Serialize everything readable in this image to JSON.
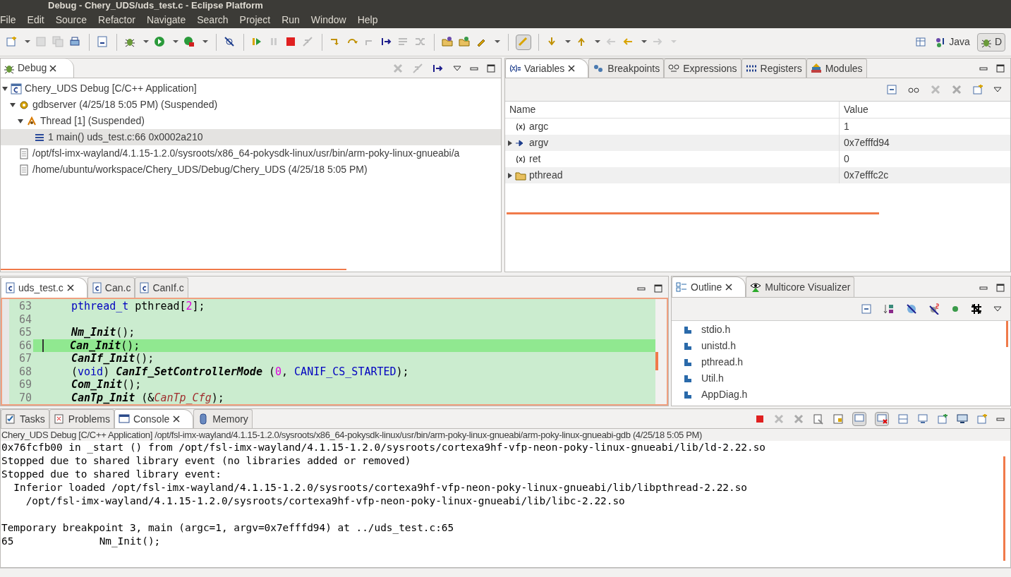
{
  "window": {
    "title": "Debug - Chery_UDS/uds_test.c - Eclipse Platform"
  },
  "menu": [
    {
      "label": "File"
    },
    {
      "label": "Edit"
    },
    {
      "label": "Source"
    },
    {
      "label": "Refactor"
    },
    {
      "label": "Navigate"
    },
    {
      "label": "Search"
    },
    {
      "label": "Project"
    },
    {
      "label": "Run"
    },
    {
      "label": "Window"
    },
    {
      "label": "Help"
    }
  ],
  "perspectives": [
    {
      "label": "Java",
      "selected": false
    },
    {
      "label": "D",
      "selected": true
    }
  ],
  "debug_view": {
    "tab": "Debug",
    "tree": [
      {
        "label": "Chery_UDS Debug [C/C++ Application]",
        "kind": "launch",
        "expanded": true,
        "selected": false,
        "children": [
          {
            "label": "gdbserver (4/25/18 5:05 PM) (Suspended)",
            "kind": "process",
            "expanded": true,
            "selected": false,
            "children": [
              {
                "label": "Thread [1] (Suspended)",
                "kind": "thread",
                "expanded": true,
                "selected": false,
                "children": [
                  {
                    "label": "1 main() uds_test.c:66 0x0002a210",
                    "kind": "frame",
                    "selected": true
                  }
                ]
              }
            ]
          },
          {
            "label": "/opt/fsl-imx-wayland/4.1.15-1.2.0/sysroots/x86_64-pokysdk-linux/usr/bin/arm-poky-linux-gnueabi/a",
            "kind": "file",
            "selected": false
          },
          {
            "label": "/home/ubuntu/workspace/Chery_UDS/Debug/Chery_UDS (4/25/18 5:05 PM)",
            "kind": "file",
            "selected": false
          }
        ]
      }
    ]
  },
  "variables_view": {
    "tabs": [
      {
        "label": "Variables",
        "selected": true
      },
      {
        "label": "Breakpoints",
        "selected": false
      },
      {
        "label": "Expressions",
        "selected": false
      },
      {
        "label": "Registers",
        "selected": false
      },
      {
        "label": "Modules",
        "selected": false
      }
    ],
    "columns": [
      "Name",
      "Value"
    ],
    "rows": [
      {
        "name": "argc",
        "value": "1",
        "kind": "local",
        "expandable": false
      },
      {
        "name": "argv",
        "value": "0x7efffd94",
        "kind": "pointer",
        "expandable": true
      },
      {
        "name": "ret",
        "value": "0",
        "kind": "local",
        "expandable": false
      },
      {
        "name": "pthread",
        "value": "0x7efffc2c",
        "kind": "array",
        "expandable": true
      }
    ]
  },
  "editor": {
    "tabs": [
      {
        "label": "uds_test.c",
        "selected": true
      },
      {
        "label": "Can.c",
        "selected": false
      },
      {
        "label": "CanIf.c",
        "selected": false
      }
    ],
    "lines": [
      {
        "number": "63",
        "current": false,
        "tokens": [
          {
            "t": "pthread_t",
            "kind": "type"
          },
          {
            "t": " pthread[",
            "kind": "plain"
          },
          {
            "t": "2",
            "kind": "num"
          },
          {
            "t": "];",
            "kind": "plain"
          }
        ]
      },
      {
        "number": "64",
        "current": false
      },
      {
        "number": "65",
        "current": false,
        "tokens": [
          {
            "t": "Nm_Init",
            "kind": "func"
          },
          {
            "t": "();",
            "kind": "plain"
          }
        ]
      },
      {
        "number": "66",
        "current": true,
        "tokens": [
          {
            "t": "Can_Init",
            "kind": "func"
          },
          {
            "t": "();",
            "kind": "plain"
          }
        ]
      },
      {
        "number": "67",
        "current": false,
        "tokens": [
          {
            "t": "CanIf_Init",
            "kind": "func"
          },
          {
            "t": "();",
            "kind": "plain"
          }
        ]
      },
      {
        "number": "68",
        "current": false,
        "tokens": [
          {
            "t": "(",
            "kind": "plain"
          },
          {
            "t": "void",
            "kind": "type"
          },
          {
            "t": ") ",
            "kind": "plain"
          },
          {
            "t": "CanIf_SetControllerMode",
            "kind": "func"
          },
          {
            "t": " (",
            "kind": "plain"
          },
          {
            "t": "0",
            "kind": "num"
          },
          {
            "t": ", ",
            "kind": "plain"
          },
          {
            "t": "CANIF_CS_STARTED",
            "kind": "macro"
          },
          {
            "t": ");",
            "kind": "plain"
          }
        ]
      },
      {
        "number": "69",
        "current": false,
        "tokens": [
          {
            "t": "Com_Init",
            "kind": "func"
          },
          {
            "t": "();",
            "kind": "plain"
          }
        ]
      },
      {
        "number": "70",
        "current": false,
        "tokens": [
          {
            "t": "CanTp_Init",
            "kind": "func"
          },
          {
            "t": " (&",
            "kind": "plain"
          },
          {
            "t": "CanTp_Cfg",
            "kind": "global"
          },
          {
            "t": ");",
            "kind": "plain"
          }
        ]
      }
    ]
  },
  "outline_view": {
    "tabs": [
      {
        "label": "Outline",
        "selected": true
      },
      {
        "label": "Multicore Visualizer",
        "selected": false
      }
    ],
    "items": [
      {
        "label": "stdio.h"
      },
      {
        "label": "unistd.h"
      },
      {
        "label": "pthread.h"
      },
      {
        "label": "Util.h"
      },
      {
        "label": "AppDiag.h"
      }
    ]
  },
  "console_view": {
    "tabs": [
      {
        "label": "Tasks",
        "selected": false
      },
      {
        "label": "Problems",
        "selected": false
      },
      {
        "label": "Console",
        "selected": true
      },
      {
        "label": "Memory",
        "selected": false
      }
    ],
    "process": "Chery_UDS Debug [C/C++ Application] /opt/fsl-imx-wayland/4.1.15-1.2.0/sysroots/x86_64-pokysdk-linux/usr/bin/arm-poky-linux-gnueabi/arm-poky-linux-gnueabi-gdb (4/25/18 5:05 PM)",
    "blocks": [
      [
        "0x76fcfb00 in _start () from /opt/fsl-imx-wayland/4.1.15-1.2.0/sysroots/cortexa9hf-vfp-neon-poky-linux-gnueabi/lib/ld-2.22.so",
        "Stopped due to shared library event (no libraries added or removed)",
        "Stopped due to shared library event:",
        "  Inferior loaded /opt/fsl-imx-wayland/4.1.15-1.2.0/sysroots/cortexa9hf-vfp-neon-poky-linux-gnueabi/lib/libpthread-2.22.so",
        "    /opt/fsl-imx-wayland/4.1.15-1.2.0/sysroots/cortexa9hf-vfp-neon-poky-linux-gnueabi/lib/libc-2.22.so"
      ],
      [
        "Temporary breakpoint 3, main (argc=1, argv=0x7efffd94) at ../uds_test.c:65",
        "65\t\tNm_Init();"
      ]
    ]
  }
}
